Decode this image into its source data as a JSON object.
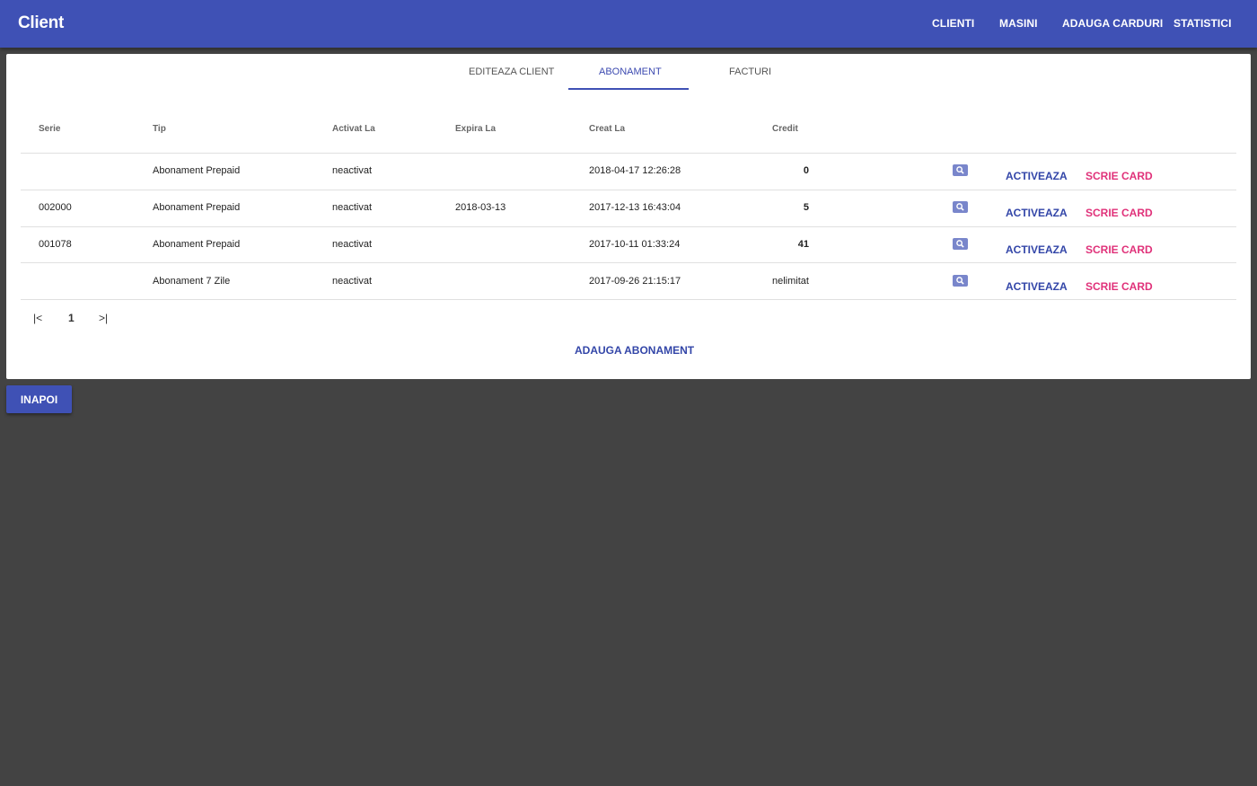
{
  "app": {
    "title": "Client"
  },
  "nav": [
    {
      "label": "CLIENTI"
    },
    {
      "label": "MASINI"
    },
    {
      "label": "ADAUGA CARDURI"
    },
    {
      "label": "STATISTICI"
    }
  ],
  "tabs": [
    {
      "label": "EDITEAZA CLIENT"
    },
    {
      "label": "ABONAMENT",
      "active": true
    },
    {
      "label": "FACTURI"
    }
  ],
  "table": {
    "headers": [
      "Serie",
      "Tip",
      "Activat La",
      "Expira La",
      "Creat La",
      "Credit"
    ],
    "rows": [
      {
        "serie": "",
        "tip": "Abonament Prepaid",
        "activat": "neactivat",
        "expira": "",
        "creat": "2018-04-17 12:26:28",
        "credit": "0",
        "activate_label": "ACTIVEAZA",
        "write_label": "SCRIE CARD"
      },
      {
        "serie": "002000",
        "tip": "Abonament Prepaid",
        "activat": "neactivat",
        "expira": "2018-03-13",
        "creat": "2017-12-13 16:43:04",
        "credit": "5",
        "activate_label": "ACTIVEAZA",
        "write_label": "SCRIE CARD"
      },
      {
        "serie": "001078",
        "tip": "Abonament Prepaid",
        "activat": "neactivat",
        "expira": "",
        "creat": "2017-10-11 01:33:24",
        "credit": "41",
        "activate_label": "ACTIVEAZA",
        "write_label": "SCRIE CARD"
      },
      {
        "serie": "",
        "tip": "Abonament 7 Zile",
        "activat": "neactivat",
        "expira": "",
        "creat": "2017-09-26 21:15:17",
        "credit": "nelimitat",
        "activate_label": "ACTIVEAZA",
        "write_label": "SCRIE CARD"
      }
    ]
  },
  "pagination": {
    "first": "|<",
    "page": "1",
    "last": ">|"
  },
  "actions": {
    "add_label": "ADAUGA ABONAMENT",
    "back_label": "INAPOI"
  },
  "colors": {
    "primary": "#3f51b5",
    "accent": "#e0327a",
    "background": "#434343"
  }
}
